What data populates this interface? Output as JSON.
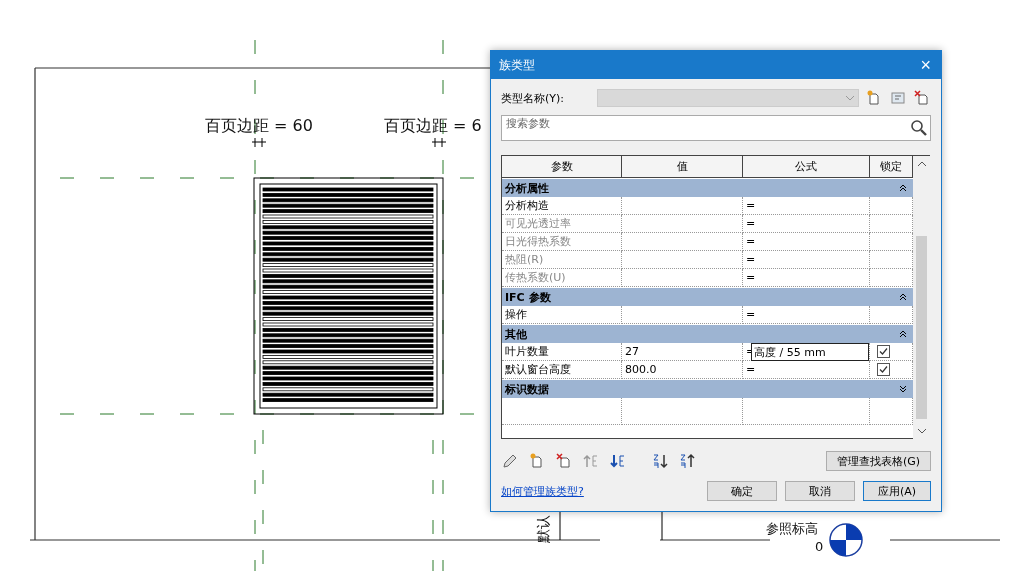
{
  "canvas": {
    "dimension_labels": [
      "百页边距 = 60",
      "百页边距 = 6"
    ],
    "vertical_label": "默认",
    "level_name": "参照标高",
    "level_value": "0"
  },
  "dialog": {
    "title": "族类型",
    "close": "×",
    "type_name_label": "类型名称(Y):",
    "search": {
      "placeholder": "搜索参数"
    },
    "columns": [
      "参数",
      "值",
      "公式",
      "锁定"
    ],
    "groups": [
      {
        "name": "分析属性",
        "expanded": true,
        "rows": [
          {
            "name": "分析构造",
            "disabled": false,
            "formula": "="
          },
          {
            "name": "可见光透过率",
            "disabled": true,
            "formula": "="
          },
          {
            "name": "日光得热系数",
            "disabled": true,
            "formula": "="
          },
          {
            "name": "热阻(R)",
            "disabled": true,
            "formula": "="
          },
          {
            "name": "传热系数(U)",
            "disabled": true,
            "formula": "="
          }
        ]
      },
      {
        "name": "IFC 参数",
        "expanded": true,
        "rows": [
          {
            "name": "操作",
            "disabled": false,
            "formula": "="
          }
        ]
      },
      {
        "name": "其他",
        "expanded": true,
        "rows": [
          {
            "name": "叶片数量",
            "disabled": false,
            "value": "27",
            "formula": "=",
            "formula_input": "高度 / 55 mm",
            "locked": true
          },
          {
            "name": "默认窗台高度",
            "disabled": false,
            "value": "800.0",
            "formula": "=",
            "locked": true
          }
        ]
      },
      {
        "name": "标识数据",
        "expanded": false
      }
    ],
    "manage_button": "管理查找表格(G)",
    "help_link": "如何管理族类型?",
    "buttons": [
      "确定",
      "取消",
      "应用(A)"
    ]
  }
}
